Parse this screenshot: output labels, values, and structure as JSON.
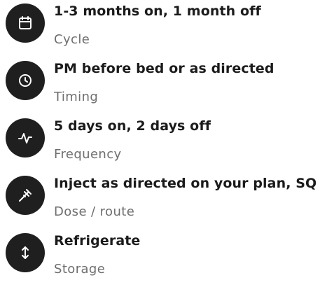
{
  "items": [
    {
      "title": "1-3 months on, 1 month off",
      "subtitle": "Cycle",
      "icon": "calendar-icon"
    },
    {
      "title": "PM before bed or as directed",
      "subtitle": "Timing",
      "icon": "clock-icon"
    },
    {
      "title": "5 days on, 2 days off",
      "subtitle": "Frequency",
      "icon": "pulse-icon"
    },
    {
      "title": "Inject as directed on your plan, SQ",
      "subtitle": "Dose / route",
      "icon": "syringe-icon"
    },
    {
      "title": "Refrigerate",
      "subtitle": "Storage",
      "icon": "vertical-arrows-icon"
    }
  ]
}
